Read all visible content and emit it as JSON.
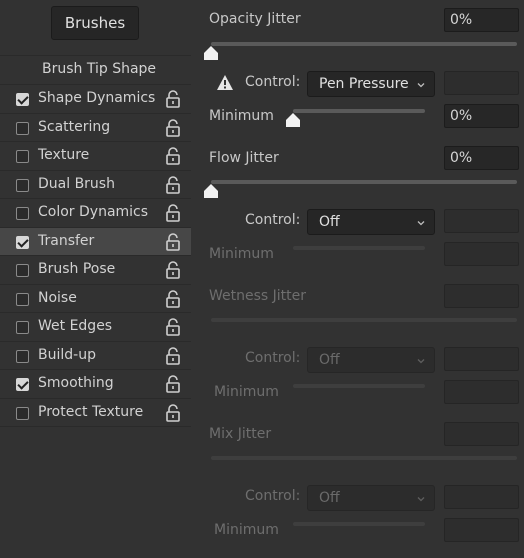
{
  "panel_button": "Brushes",
  "sidebar": {
    "tip_label": "Brush Tip Shape",
    "items": [
      {
        "label": "Shape Dynamics",
        "checked": true
      },
      {
        "label": "Scattering",
        "checked": false
      },
      {
        "label": "Texture",
        "checked": false
      },
      {
        "label": "Dual Brush",
        "checked": false
      },
      {
        "label": "Color Dynamics",
        "checked": false
      },
      {
        "label": "Transfer",
        "checked": true,
        "selected": true
      },
      {
        "label": "Brush Pose",
        "checked": false
      },
      {
        "label": "Noise",
        "checked": false
      },
      {
        "label": "Wet Edges",
        "checked": false
      },
      {
        "label": "Build-up",
        "checked": false
      },
      {
        "label": "Smoothing",
        "checked": true
      },
      {
        "label": "Protect Texture",
        "checked": false
      }
    ]
  },
  "opacity": {
    "label": "Opacity Jitter",
    "value": "0%",
    "level": 0,
    "control_label": "Control:",
    "control_value": "Pen Pressure",
    "minimum_label": "Minimum",
    "minimum_value": "0%",
    "minimum_level": 0,
    "warning_icon": "warning-triangle-icon"
  },
  "flow": {
    "label": "Flow Jitter",
    "value": "0%",
    "level": 0,
    "control_label": "Control:",
    "control_value": "Off",
    "minimum_label": "Minimum",
    "minimum_value": ""
  },
  "wetness": {
    "label": "Wetness Jitter",
    "value": "",
    "control_label": "Control:",
    "control_value": "Off",
    "minimum_label": "Minimum",
    "minimum_value": ""
  },
  "mix": {
    "label": "Mix Jitter",
    "value": "",
    "control_label": "Control:",
    "control_value": "Off",
    "minimum_label": "Minimum",
    "minimum_value": ""
  }
}
